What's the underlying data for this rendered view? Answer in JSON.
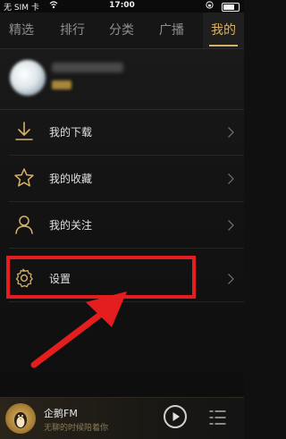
{
  "status_bar": {
    "carrier": "无 SIM 卡",
    "time": "17:00"
  },
  "tabs": [
    {
      "label": "精选",
      "active": false
    },
    {
      "label": "排行",
      "active": false
    },
    {
      "label": "分类",
      "active": false
    },
    {
      "label": "广播",
      "active": false
    },
    {
      "label": "我的",
      "active": true
    }
  ],
  "menu": [
    {
      "label": "我的下载",
      "icon": "download-icon"
    },
    {
      "label": "我的收藏",
      "icon": "star-icon"
    },
    {
      "label": "我的关注",
      "icon": "person-icon"
    },
    {
      "label": "设置",
      "icon": "gear-icon"
    }
  ],
  "player": {
    "title": "企鹅FM",
    "subtitle": "无聊的时候陪着你"
  },
  "colors": {
    "accent": "#d8b165",
    "highlight": "#e41e1e"
  }
}
